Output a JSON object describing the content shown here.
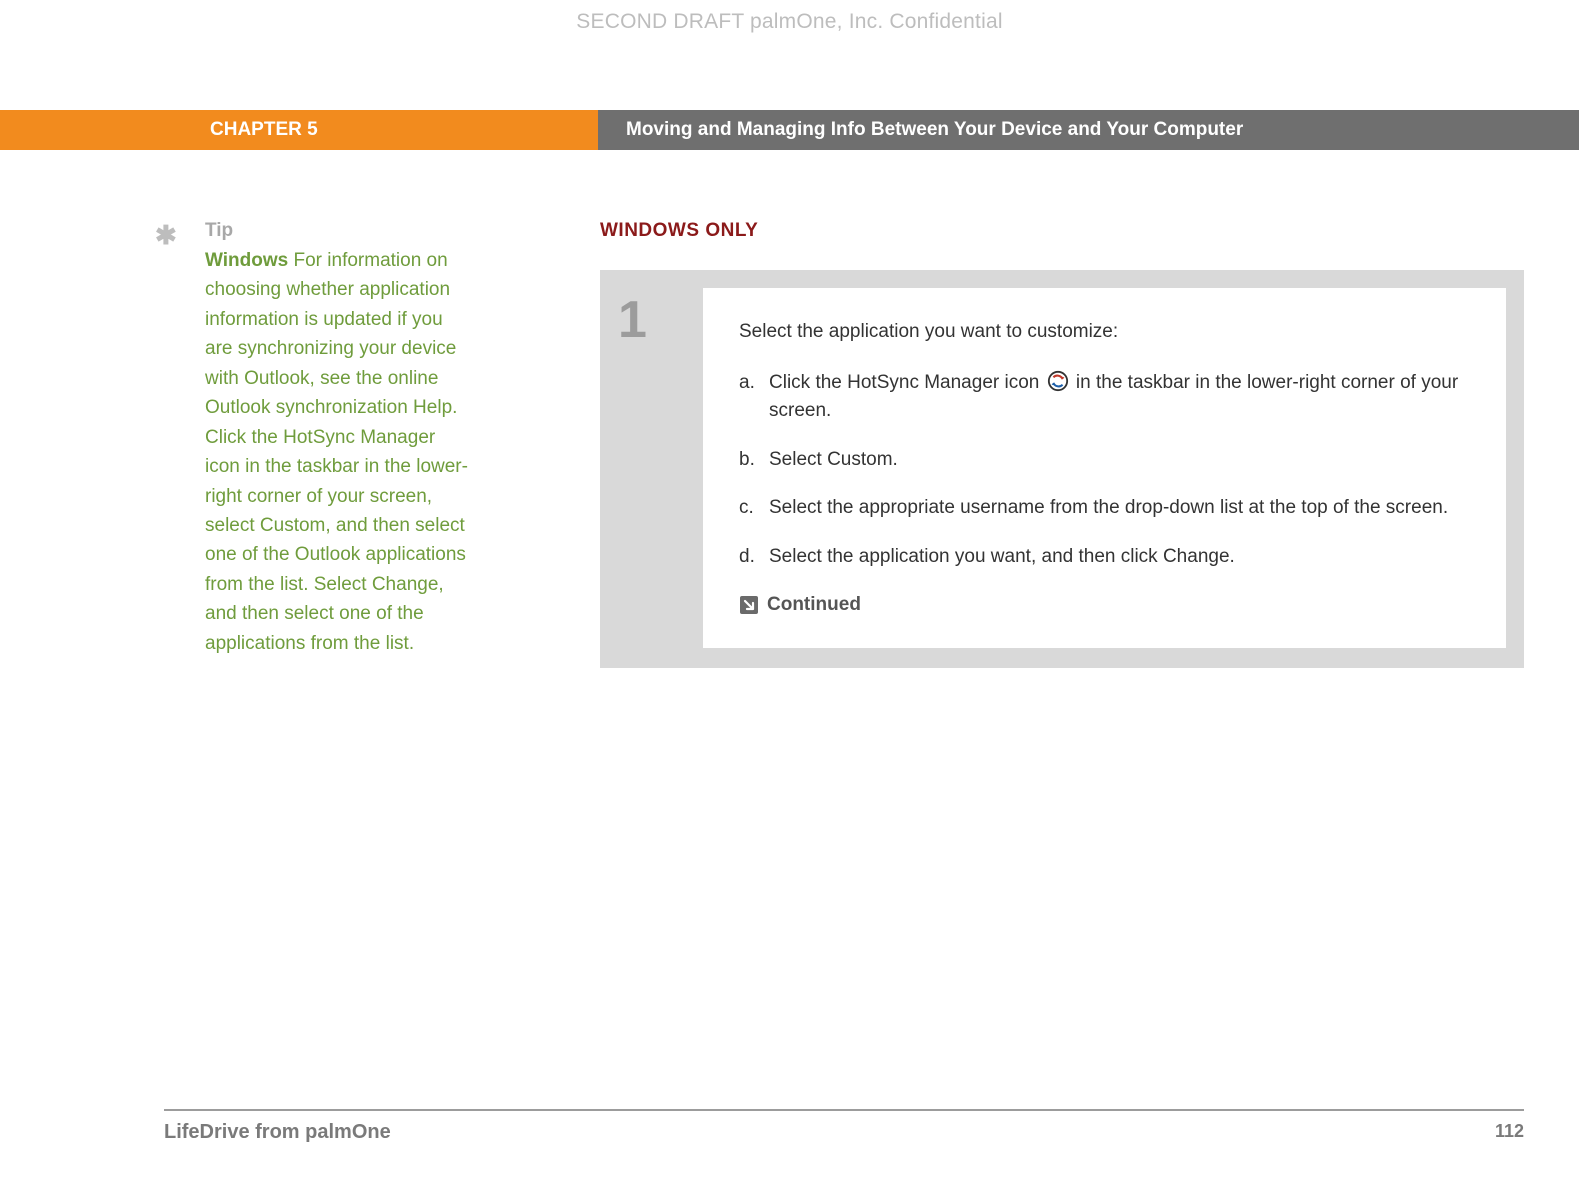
{
  "watermark": "SECOND DRAFT palmOne, Inc.  Confidential",
  "header": {
    "chapter": "CHAPTER 5",
    "title": "Moving and Managing Info Between Your Device and Your Computer"
  },
  "tip": {
    "label": "Tip",
    "bold_start": "Windows",
    "body_rest": "   For information on choosing whether application information is updated if you are synchronizing your device with Outlook, see the online Outlook synchronization Help. Click the HotSync Manager icon in the taskbar in the lower-right corner of your screen, select Custom, and then select one of the Outlook applications from the list. Select Change, and then select one of the applications from the list."
  },
  "main": {
    "section_label": "WINDOWS ONLY",
    "step_number": "1",
    "step_intro": "Select the application you want to customize:",
    "substeps": {
      "a_letter": "a.",
      "a_pre": "Click the HotSync Manager icon ",
      "a_post": " in the taskbar in the lower-right corner of your screen.",
      "b_letter": "b.",
      "b_text": "Select Custom.",
      "c_letter": "c.",
      "c_text": "Select the appropriate username from the drop-down list at the top of the screen.",
      "d_letter": "d.",
      "d_text": "Select the application you want, and then click Change."
    },
    "continued_label": "Continued"
  },
  "footer": {
    "title": "LifeDrive from palmOne",
    "page": "112"
  }
}
